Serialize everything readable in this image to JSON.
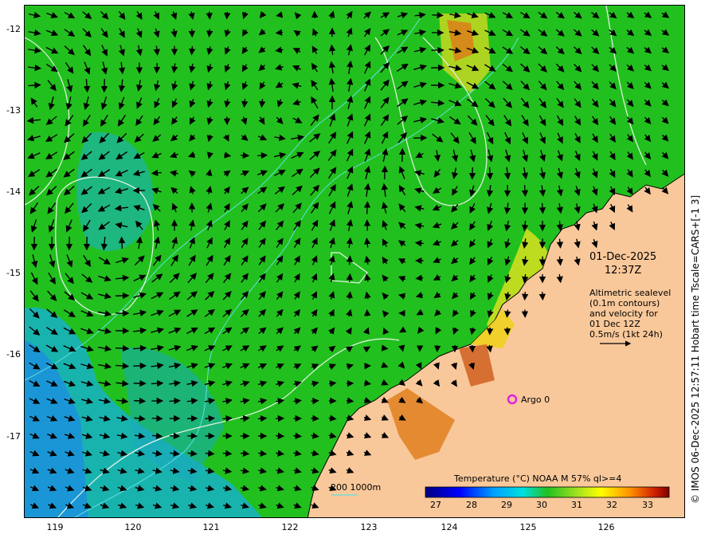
{
  "map": {
    "date": "01-Dec-2025",
    "time": "12:37Z",
    "altimetry_note": [
      "Altimetric sealevel",
      "(0.1m contours)",
      "and velocity for",
      "01 Dec 12Z",
      "0.5m/s (1kt 24h)"
    ],
    "argo_label": "Argo 0",
    "depth_legend": "200  1000m",
    "credit": "© IMOS 06-Dec-2025 12:57:11 Hobart time Tscale=CARS+[-1 3]",
    "lat_ticks": [
      "-12",
      "-13",
      "-14",
      "-15",
      "-16",
      "-17"
    ],
    "lon_ticks": [
      "119",
      "120",
      "121",
      "122",
      "123",
      "124",
      "125",
      "126"
    ],
    "colors": {
      "land": "#f9c89a",
      "ocean_mid": "#22c01e",
      "cool": "#1aa6e8",
      "warm": "#f0e010",
      "hot": "#d05010",
      "contour": "#e8f4e8",
      "bathy": "#60e0e0",
      "argo": "#e020e0"
    }
  },
  "colorbar": {
    "title": "Temperature (°C) NOAA  M 57% ql>=4",
    "ticks": [
      "27",
      "28",
      "29",
      "30",
      "31",
      "32",
      "33"
    ],
    "min": 26.6,
    "max": 33.6
  }
}
